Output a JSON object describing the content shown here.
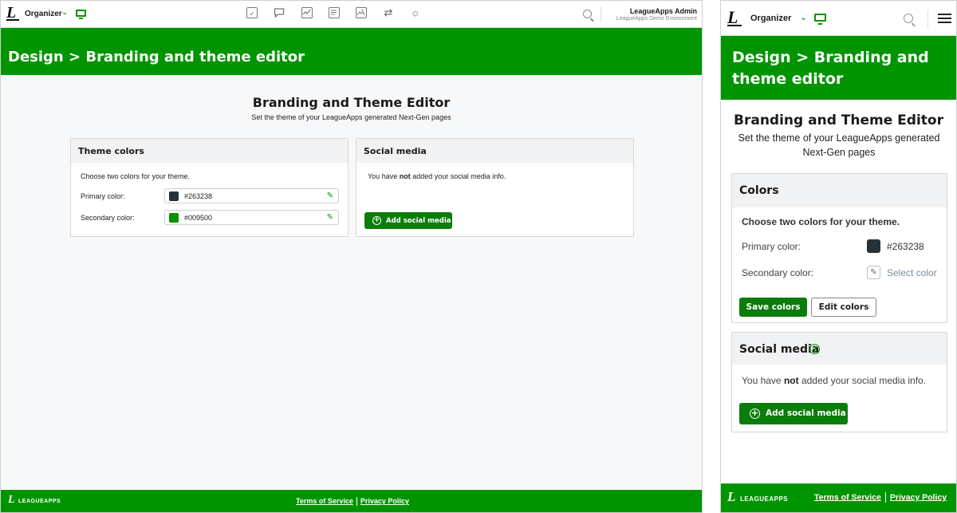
{
  "header": {
    "logo_glyph": "L",
    "org_label": "Organizer",
    "user_name": "LeagueApps Admin",
    "user_env": "LeagueApps Demo Environment",
    "nav_icons": [
      "checklist-icon",
      "chat-icon",
      "chart-icon",
      "document-icon",
      "image-icon",
      "transfer-icon",
      "gear-icon"
    ]
  },
  "banner": {
    "desktop_title": "Design > Branding and theme editor",
    "mobile_title": "Design > Branding and theme editor"
  },
  "page": {
    "title": "Branding and Theme Editor",
    "subtitle": "Set the theme of your LeagueApps generated Next-Gen pages"
  },
  "theme_card": {
    "heading": "Theme colors",
    "intro": "Choose two colors for your theme.",
    "primary_label": "Primary color:",
    "primary_value": "#263238",
    "primary_swatch": "#263238",
    "secondary_label": "Secondary color:",
    "secondary_value": "#009500",
    "secondary_swatch": "#009500"
  },
  "social_card": {
    "heading": "Social media",
    "text_before": "You have ",
    "text_bold": "not",
    "text_after": " added your social media info.",
    "add_button": "Add social media"
  },
  "mobile_colors_card": {
    "heading": "Colors",
    "intro": "Choose two colors for your theme.",
    "primary_label": "Primary color:",
    "primary_value": "#263238",
    "secondary_label": "Secondary color:",
    "secondary_placeholder": "Select color",
    "save_button": "Save colors",
    "edit_button": "Edit colors"
  },
  "footer": {
    "logo_text": "LEAGUEAPPS",
    "terms": "Terms of Service",
    "privacy": "Privacy Policy"
  },
  "colors": {
    "brand_green": "#009500",
    "button_green": "#0a7d0a",
    "primary": "#263238"
  }
}
